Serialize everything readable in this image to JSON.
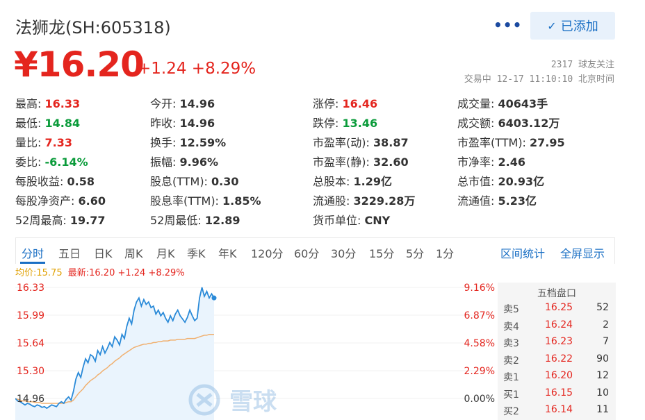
{
  "header": {
    "title": "法狮龙(SH:605318)",
    "more_label": "•••",
    "added_label": "已添加",
    "check_glyph": "✓"
  },
  "quote": {
    "price": "¥16.20",
    "change": "+1.24 +8.29%",
    "followers": "2317 球友关注",
    "status": "交易中 12-17 11:10:10 北京时间"
  },
  "stats": [
    {
      "label": "最高:",
      "value": "16.33",
      "color": "red"
    },
    {
      "label": "今开:",
      "value": "14.96",
      "color": "dark"
    },
    {
      "label": "涨停:",
      "value": "16.46",
      "color": "red"
    },
    {
      "label": "成交量:",
      "value": "40643手",
      "color": "dark"
    },
    {
      "label": "最低:",
      "value": "14.84",
      "color": "green"
    },
    {
      "label": "昨收:",
      "value": "14.96",
      "color": "dark"
    },
    {
      "label": "跌停:",
      "value": "13.46",
      "color": "green"
    },
    {
      "label": "成交额:",
      "value": "6403.12万",
      "color": "dark"
    },
    {
      "label": "量比:",
      "value": "7.33",
      "color": "red"
    },
    {
      "label": "换手:",
      "value": "12.59%",
      "color": "dark"
    },
    {
      "label": "市盈率(动):",
      "value": "38.87",
      "color": "dark"
    },
    {
      "label": "市盈率(TTM):",
      "value": "27.95",
      "color": "dark"
    },
    {
      "label": "委比:",
      "value": "-6.14%",
      "color": "green"
    },
    {
      "label": "振幅:",
      "value": "9.96%",
      "color": "dark"
    },
    {
      "label": "市盈率(静):",
      "value": "32.60",
      "color": "dark"
    },
    {
      "label": "市净率:",
      "value": "2.46",
      "color": "dark"
    },
    {
      "label": "每股收益:",
      "value": "0.58",
      "color": "dark"
    },
    {
      "label": "股息(TTM):",
      "value": "0.30",
      "color": "dark"
    },
    {
      "label": "总股本:",
      "value": "1.29亿",
      "color": "dark"
    },
    {
      "label": "总市值:",
      "value": "20.93亿",
      "color": "dark"
    },
    {
      "label": "每股净资产:",
      "value": "6.60",
      "color": "dark"
    },
    {
      "label": "股息率(TTM):",
      "value": "1.85%",
      "color": "dark"
    },
    {
      "label": "流通股:",
      "value": "3229.28万",
      "color": "dark"
    },
    {
      "label": "流通值:",
      "value": "5.23亿",
      "color": "dark"
    },
    {
      "label": "52周最高:",
      "value": "19.77",
      "color": "dark"
    },
    {
      "label": "52周最低:",
      "value": "12.89",
      "color": "dark"
    },
    {
      "label": "货币单位:",
      "value": "CNY",
      "color": "dark"
    }
  ],
  "tabs": [
    "分时",
    "五日",
    "日K",
    "周K",
    "月K",
    "季K",
    "年K",
    "120分",
    "60分",
    "30分",
    "15分",
    "5分",
    "1分"
  ],
  "tabs_right": [
    "区间统计",
    "全屏显示"
  ],
  "legend": {
    "avg": "均价:15.75",
    "latest": "最新:16.20 +1.24 +8.29%"
  },
  "chart_data": {
    "type": "line",
    "y_ticks": [
      "16.33",
      "15.99",
      "15.64",
      "15.30",
      "14.96"
    ],
    "pct_ticks": [
      "9.16%",
      "6.87%",
      "4.58%",
      "2.29%",
      "0.00%"
    ],
    "ylim": [
      14.96,
      16.33
    ],
    "series": [
      {
        "values": [
          14.96,
          14.93,
          14.92,
          14.9,
          14.88,
          14.9,
          14.89,
          14.87,
          14.86,
          14.88,
          14.87,
          14.85,
          14.86,
          14.84,
          14.86,
          14.88,
          14.87,
          14.86,
          14.9,
          14.92,
          14.9,
          14.95,
          14.98,
          14.94,
          15.05,
          15.2,
          15.28,
          15.22,
          15.35,
          15.45,
          15.4,
          15.5,
          15.48,
          15.42,
          15.55,
          15.5,
          15.6,
          15.52,
          15.58,
          15.65,
          15.6,
          15.72,
          15.68,
          15.62,
          15.75,
          15.7,
          15.85,
          15.95,
          15.88,
          16.05,
          16.15,
          16.2,
          16.1,
          16.18,
          16.12,
          16.15,
          16.08,
          16.1,
          16.0,
          16.05,
          15.98,
          16.02,
          15.95,
          15.9,
          15.98,
          15.92,
          16.0,
          16.05,
          15.98,
          15.94,
          15.9,
          15.96,
          16.05,
          15.98,
          15.92,
          15.95,
          16.2,
          16.33,
          16.22,
          16.28,
          16.2,
          16.25,
          16.2
        ]
      },
      {
        "values": [
          14.96,
          14.95,
          14.94,
          14.93,
          14.93,
          14.92,
          14.92,
          14.92,
          14.91,
          14.91,
          14.91,
          14.9,
          14.9,
          14.9,
          14.9,
          14.9,
          14.9,
          14.9,
          14.9,
          14.9,
          14.9,
          14.91,
          14.92,
          14.92,
          14.94,
          14.98,
          15.02,
          15.05,
          15.08,
          15.12,
          15.15,
          15.18,
          15.2,
          15.22,
          15.25,
          15.27,
          15.3,
          15.32,
          15.34,
          15.37,
          15.39,
          15.42,
          15.44,
          15.46,
          15.49,
          15.51,
          15.53,
          15.55,
          15.57,
          15.59,
          15.6,
          15.61,
          15.62,
          15.63,
          15.63,
          15.64,
          15.64,
          15.65,
          15.65,
          15.66,
          15.66,
          15.67,
          15.67,
          15.67,
          15.68,
          15.68,
          15.68,
          15.69,
          15.69,
          15.69,
          15.69,
          15.7,
          15.7,
          15.7,
          15.7,
          15.71,
          15.72,
          15.73,
          15.74,
          15.74,
          15.75,
          15.75,
          15.75
        ]
      }
    ]
  },
  "orderbook": {
    "title": "五档盘口",
    "rows": [
      {
        "side": "卖5",
        "price": "16.25",
        "vol": "52"
      },
      {
        "side": "卖4",
        "price": "16.24",
        "vol": "2"
      },
      {
        "side": "卖3",
        "price": "16.23",
        "vol": "7"
      },
      {
        "side": "卖2",
        "price": "16.22",
        "vol": "90"
      },
      {
        "side": "卖1",
        "price": "16.20",
        "vol": "12"
      },
      {
        "side": "买1",
        "price": "16.15",
        "vol": "10"
      },
      {
        "side": "买2",
        "price": "16.14",
        "vol": "11"
      }
    ]
  },
  "watermark": {
    "text": "雪球",
    "icon": "snowball-logo-icon"
  },
  "colors": {
    "up": "#e4251e",
    "down": "#0a9b3a",
    "accent": "#1a6fc4",
    "avg": "#f0b070",
    "price_line": "#2a8ad8"
  }
}
